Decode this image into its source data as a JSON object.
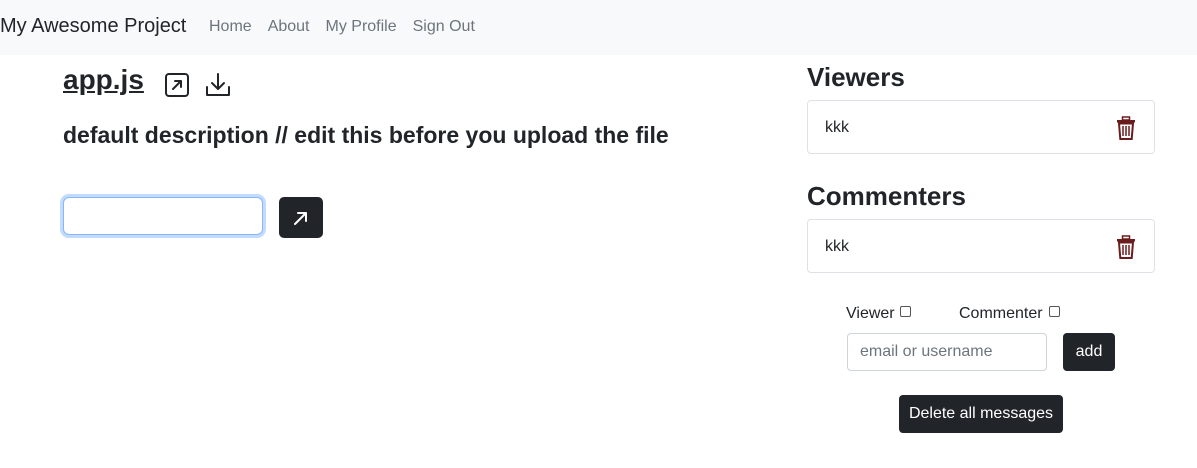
{
  "navbar": {
    "brand": "My Awesome Project",
    "links": [
      {
        "label": "Home"
      },
      {
        "label": "About"
      },
      {
        "label": "My Profile"
      },
      {
        "label": "Sign Out"
      }
    ]
  },
  "file": {
    "name": "app.js",
    "description": "default description // edit this before you upload the file",
    "icons": {
      "open": "external-link-icon",
      "download": "download-icon",
      "send": "arrow-up-right-icon"
    },
    "comment_input_value": ""
  },
  "viewers": {
    "title": "Viewers",
    "items": [
      {
        "name": "kkk"
      }
    ]
  },
  "commenters": {
    "title": "Commenters",
    "items": [
      {
        "name": "kkk"
      }
    ]
  },
  "add_user": {
    "viewer_label": "Viewer",
    "viewer_checked": false,
    "commenter_label": "Commenter",
    "commenter_checked": false,
    "input_placeholder": "email or username",
    "add_label": "add"
  },
  "delete_all_label": "Delete all messages",
  "colors": {
    "trash": "#6b1d1d",
    "dark_button": "#212529",
    "focus_border": "#86b7fe"
  }
}
